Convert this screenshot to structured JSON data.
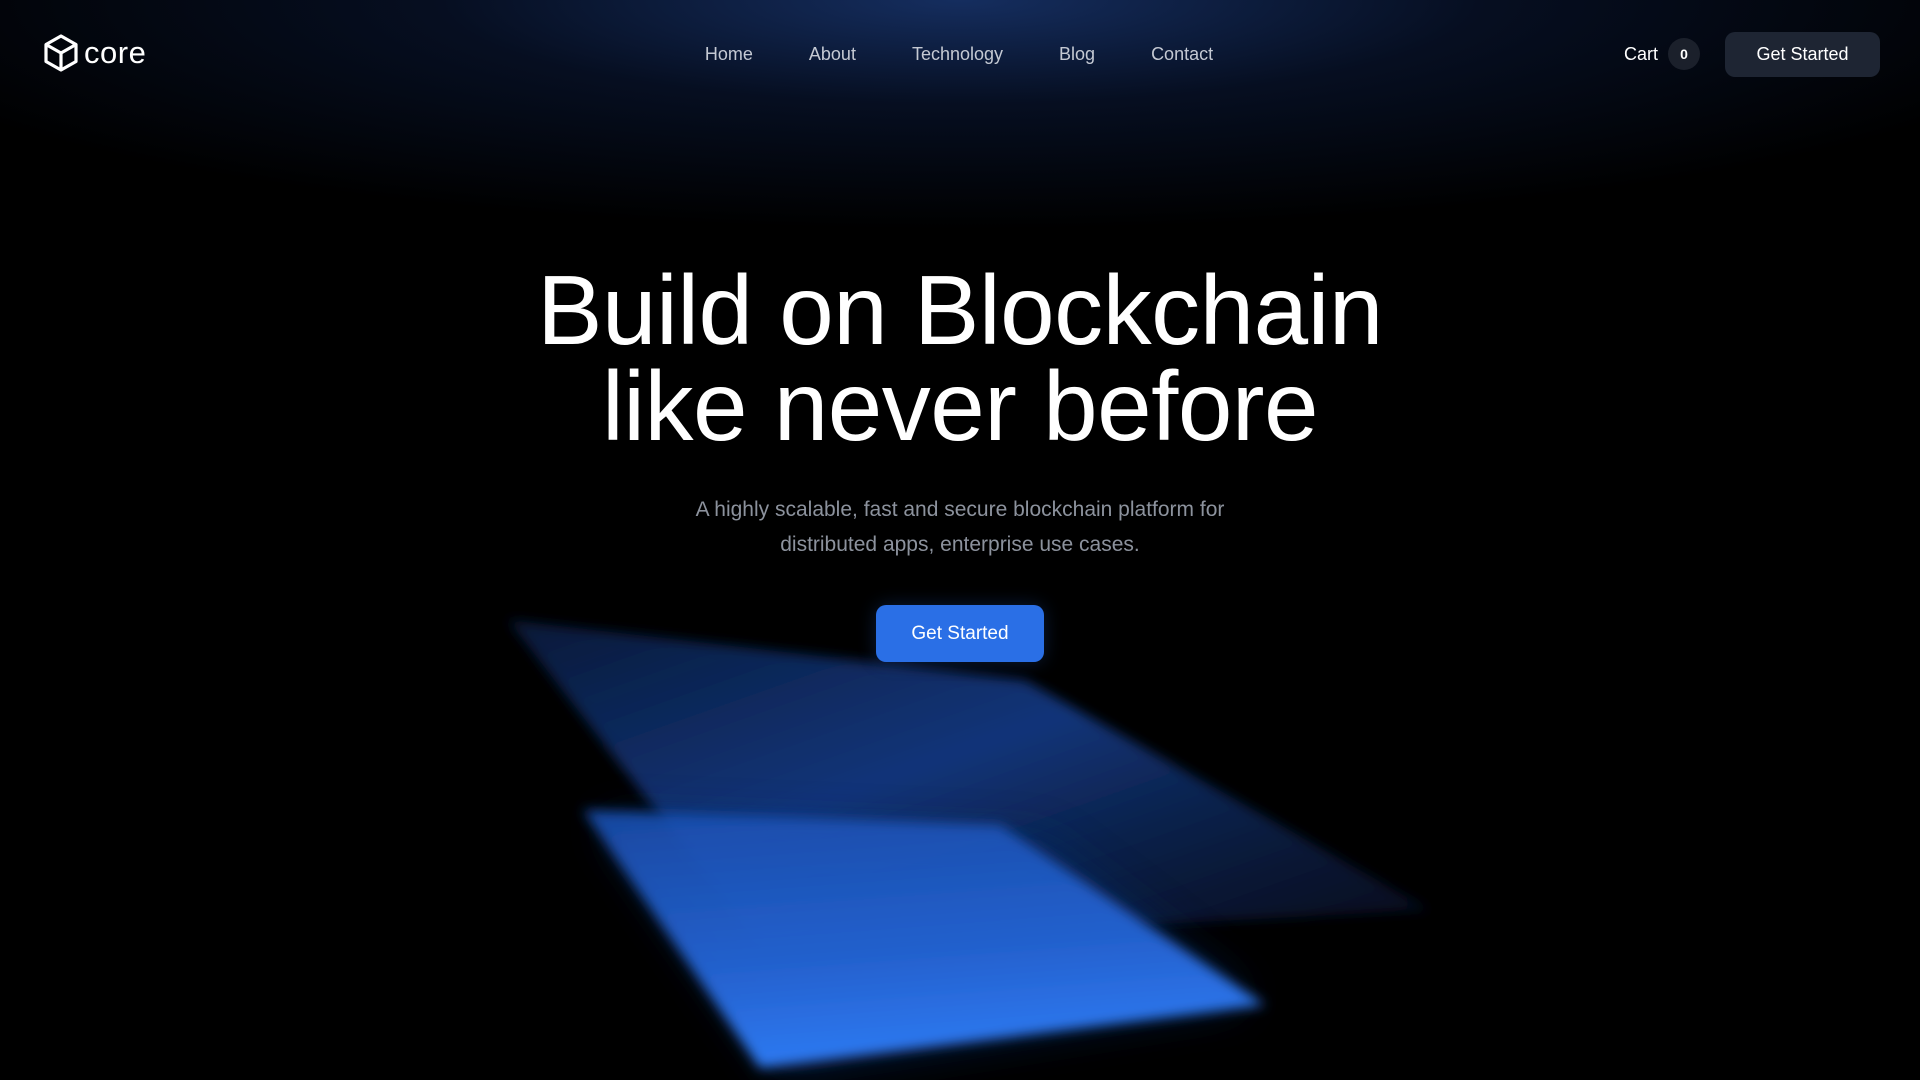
{
  "brand": {
    "name": "core",
    "logo_icon": "cube-icon"
  },
  "nav": {
    "items": [
      {
        "label": "Home"
      },
      {
        "label": "About"
      },
      {
        "label": "Technology"
      },
      {
        "label": "Blog"
      },
      {
        "label": "Contact"
      }
    ]
  },
  "cart": {
    "label": "Cart",
    "count": "0"
  },
  "header": {
    "cta_label": "Get Started"
  },
  "hero": {
    "title_line1": "Build on Blockchain",
    "title_line2": "like never before",
    "subtitle_line1": "A highly scalable, fast and secure blockchain platform for",
    "subtitle_line2": "distributed apps, enterprise use cases.",
    "cta_label": "Get Started"
  },
  "colors": {
    "background": "#000000",
    "accent": "#2a6fe6",
    "header_button": "#1e2533",
    "nav_text": "#c4c9d3",
    "subtitle_text": "#8c929d"
  }
}
